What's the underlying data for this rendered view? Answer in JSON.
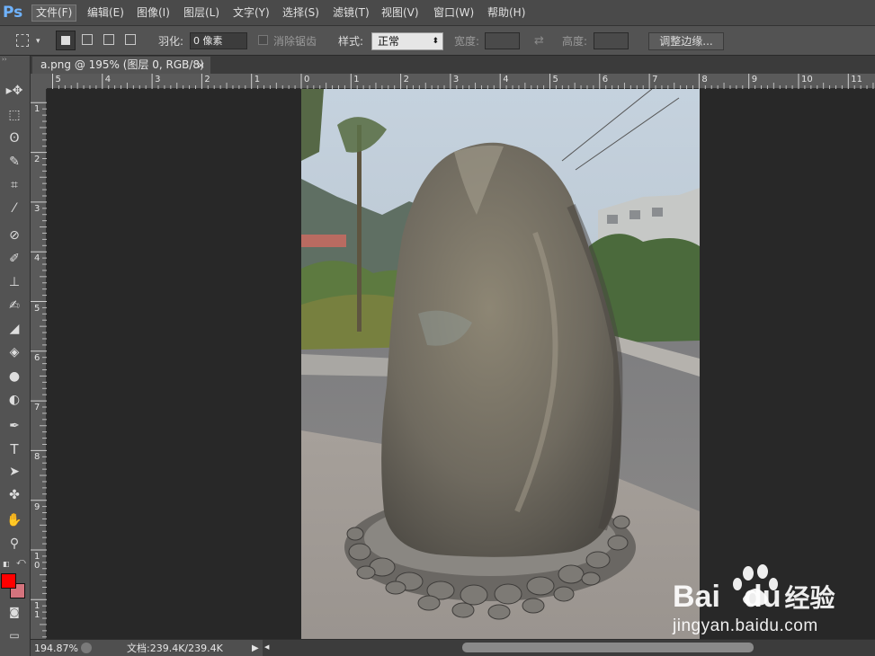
{
  "app": {
    "logo": "Ps"
  },
  "menu": {
    "items": [
      {
        "label": "文件(F)",
        "name": "menu-file"
      },
      {
        "label": "编辑(E)",
        "name": "menu-edit"
      },
      {
        "label": "图像(I)",
        "name": "menu-image"
      },
      {
        "label": "图层(L)",
        "name": "menu-layer"
      },
      {
        "label": "文字(Y)",
        "name": "menu-type"
      },
      {
        "label": "选择(S)",
        "name": "menu-select"
      },
      {
        "label": "滤镜(T)",
        "name": "menu-filter"
      },
      {
        "label": "视图(V)",
        "name": "menu-view"
      },
      {
        "label": "窗口(W)",
        "name": "menu-window"
      },
      {
        "label": "帮助(H)",
        "name": "menu-help"
      }
    ]
  },
  "options": {
    "feather_label": "羽化:",
    "feather_value": "0 像素",
    "antialias_label": "消除锯齿",
    "style_label": "样式:",
    "style_value": "正常",
    "width_label": "宽度:",
    "height_label": "高度:",
    "refine_edge": "调整边缘..."
  },
  "document": {
    "tab_title": "a.png @ 195% (图层 0, RGB/8)",
    "close_glyph": "×"
  },
  "ruler": {
    "h_labels": [
      "5",
      "4",
      "3",
      "2",
      "1",
      "0",
      "1",
      "2",
      "3",
      "4",
      "5",
      "6",
      "7",
      "8",
      "9",
      "10",
      "11"
    ],
    "v_labels": [
      "1",
      "2",
      "3",
      "4",
      "5",
      "6",
      "7",
      "8",
      "9",
      "1\n0",
      "1\n1"
    ]
  },
  "status": {
    "zoom": "194.87%",
    "doc_info": "文档:239.4K/239.4K",
    "arrow_right": "▶",
    "arrow_left": "◀"
  },
  "watermark": {
    "brand": "Bai",
    "brand2": "du",
    "cn": "经验",
    "url": "jingyan.baidu.com"
  },
  "colors": {
    "foreground": "#ff0000",
    "background": "#d4737d",
    "accent": "#6fb3ff"
  },
  "icons": {
    "tools": [
      "move-icon",
      "marquee-icon",
      "lasso-icon",
      "quick-select-icon",
      "crop-icon",
      "eyedropper-icon",
      "healing-icon",
      "brush-icon",
      "stamp-icon",
      "history-brush-icon",
      "eraser-icon",
      "bucket-icon",
      "blur-icon",
      "dodge-icon",
      "pen-icon",
      "type-icon",
      "path-select-icon",
      "shape-icon",
      "hand-icon",
      "zoom-icon"
    ]
  }
}
